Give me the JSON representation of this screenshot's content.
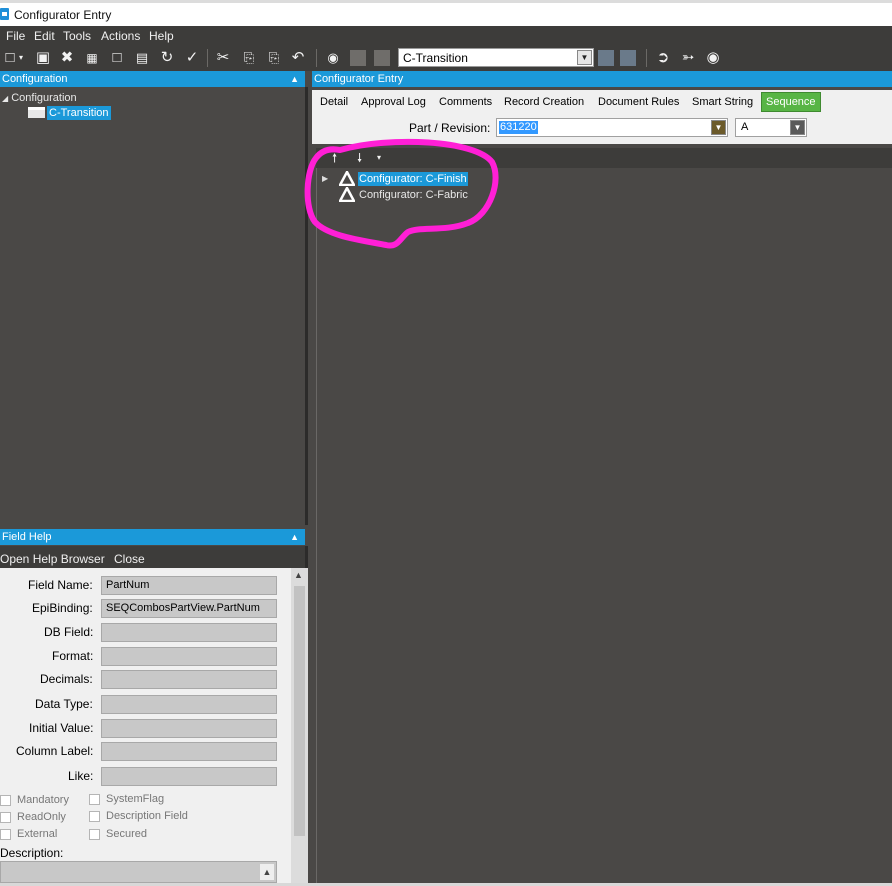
{
  "window": {
    "title": "Configurator Entry"
  },
  "menu": [
    "File",
    "Edit",
    "Tools",
    "Actions",
    "Help"
  ],
  "toolbar": {
    "navigator_value": "C-Transition"
  },
  "left_panel": {
    "header": "Configuration",
    "tree": {
      "root": "Configuration",
      "child": "C-Transition"
    }
  },
  "help_panel": {
    "header": "Field Help",
    "actions": [
      "Open Help Browser",
      "Close"
    ],
    "fields": [
      {
        "label": "Field Name:",
        "value": "PartNum"
      },
      {
        "label": "EpiBinding:",
        "value": "SEQCombosPartView.PartNum"
      },
      {
        "label": "DB Field:",
        "value": ""
      },
      {
        "label": "Format:",
        "value": ""
      },
      {
        "label": "Decimals:",
        "value": ""
      },
      {
        "label": "Data Type:",
        "value": ""
      },
      {
        "label": "Initial Value:",
        "value": ""
      },
      {
        "label": "Column Label:",
        "value": ""
      },
      {
        "label": "Like:",
        "value": ""
      }
    ],
    "checks_left": [
      "Mandatory",
      "ReadOnly",
      "External"
    ],
    "checks_right": [
      "SystemFlag",
      "Description Field",
      "Secured"
    ],
    "description_label": "Description:"
  },
  "right_panel": {
    "header": "Configurator Entry",
    "tabs": [
      "Detail",
      "Approval Log",
      "Comments",
      "Record Creation",
      "Document Rules",
      "Smart String",
      "Sequence"
    ],
    "active_tab": "Sequence",
    "part_label": "Part / Revision:",
    "part_value": "631220",
    "revision_value": "A",
    "sequence_items": [
      {
        "label": "Configurator: C-Finish",
        "selected": true,
        "expandable": true
      },
      {
        "label": "Configurator: C-Fabric",
        "selected": false,
        "expandable": false
      }
    ]
  },
  "colors": {
    "panel_header": "#1b99d9",
    "active_tab": "#58b545",
    "annotation": "#ff1fd6",
    "background": "#4a4846"
  }
}
